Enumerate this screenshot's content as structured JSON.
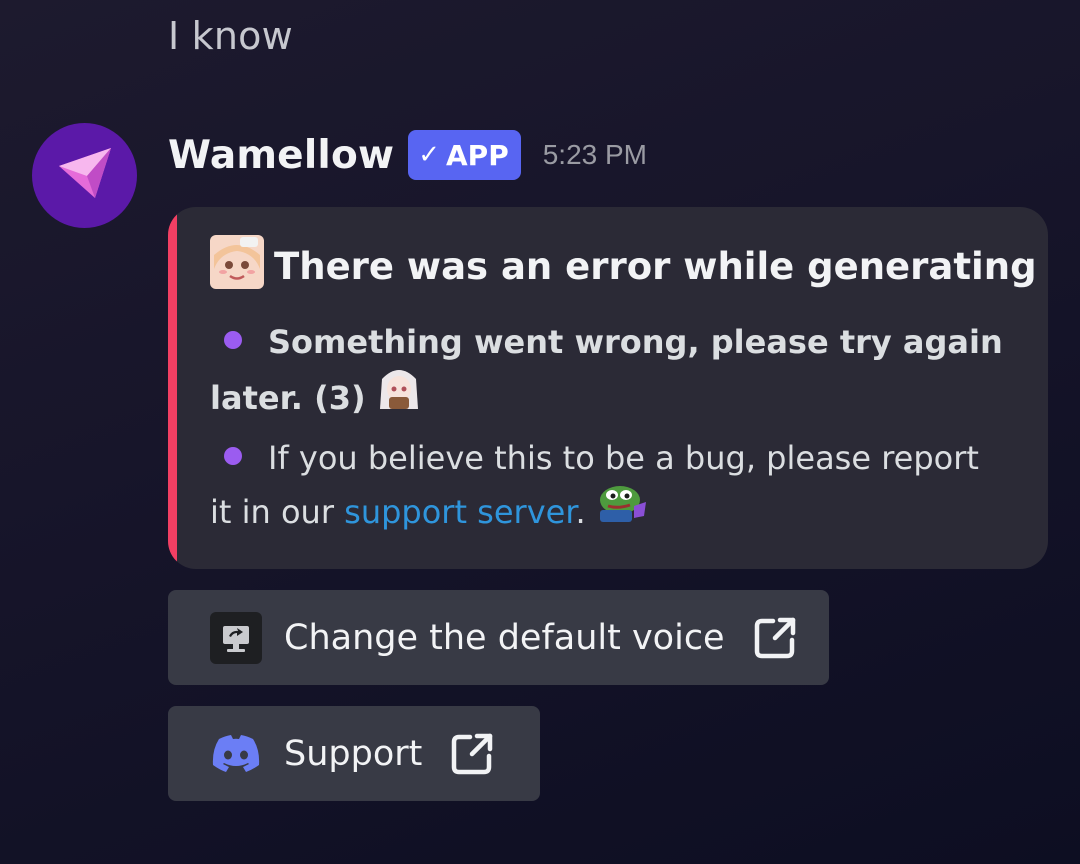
{
  "previous_message": {
    "text": "I know"
  },
  "message": {
    "author": "Wamellow",
    "badge_label": "APP",
    "timestamp": "5:23 PM",
    "avatar_icon": "paper-plane-icon",
    "embed": {
      "accent_color": "#f23f63",
      "title": "There was an error while generating",
      "title_icon": "anime-girl-emoji",
      "line1": "Something went wrong, please try again later. (3)",
      "line1_icon": "anime-girl-emoji",
      "line2_prefix": "If you believe this to be a bug, please report it in our",
      "line2_link": "support server",
      "line2_suffix": ".",
      "line2_icon": "pepe-frog-emoji"
    },
    "buttons": [
      {
        "label": "Change the default voice",
        "icon": "monitor-refresh-icon",
        "trailing_icon": "external-link-icon"
      },
      {
        "label": "Support",
        "icon": "discord-icon",
        "trailing_icon": "external-link-icon"
      }
    ]
  },
  "colors": {
    "badge": "#5865f2",
    "link": "#2f95dc",
    "bullet": "#9b5cf0",
    "avatar_bg": "#5b19a8"
  }
}
